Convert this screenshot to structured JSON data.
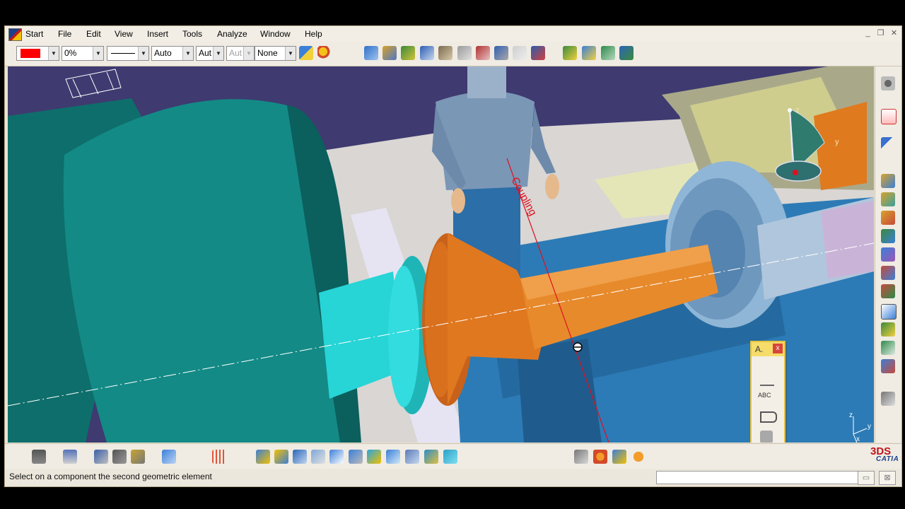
{
  "app": {
    "name": "CATIA",
    "brand_mark": "3DS"
  },
  "menu": {
    "items": [
      "Start",
      "File",
      "Edit",
      "View",
      "Insert",
      "Tools",
      "Analyze",
      "Window",
      "Help"
    ]
  },
  "window_controls": {
    "minimize": "_",
    "restore": "❐",
    "close": "✕"
  },
  "graphic_properties": {
    "fill_color": "#ff0000",
    "transparency": "0%",
    "line_type_icon": "solid-line-icon",
    "line_thickness": "Auto",
    "line_weight": "Aut",
    "point_symbol": "Aut",
    "layer": "None"
  },
  "annotation_toolbar": {
    "title": "A.",
    "close_label": "x",
    "text_tool_label": "ABC",
    "icons": [
      "leader-line-icon",
      "text-abc-icon",
      "flag-note-icon",
      "hand-annotation-icon",
      "annotation-3d-icon"
    ]
  },
  "viewport": {
    "annotation_text": "Coupling",
    "compass_axes": {
      "z": "z",
      "y": "y"
    },
    "corner_axes": {
      "z": "z",
      "y": "y",
      "x": "x"
    },
    "colors": {
      "background": "#3f3a70",
      "motor": "#138a86",
      "floor": "#d9d6d3",
      "coupling": "#e07820",
      "hub": "#27d4d6",
      "base": "#2c7bb6",
      "flange": "#8fb6d6",
      "annotation": "#e01020"
    }
  },
  "status": {
    "message": "Select on a component the second geometric element",
    "command_input": ""
  },
  "toolbar_icons": {
    "top": [
      "paint-brush-icon",
      "format-painter-icon",
      "assembly-constraint-icon",
      "product-icon",
      "components-icon",
      "manipulation-icon",
      "snap-icon",
      "measure-icon",
      "clash-icon",
      "section-icon",
      "selection-icon",
      "explode-icon",
      "update-icon",
      "product-structure-icon",
      "catalog-icon",
      "scenes-icon"
    ],
    "right": [
      "settings-gear-icon",
      "pdf-export-icon",
      "select-arrow-icon",
      "gear-constraint-icon",
      "gear-offset-icon",
      "gear-angle-icon",
      "insert-component-icon",
      "replace-component-icon",
      "reuse-pattern-icon",
      "multi-instantiation-icon",
      "annotation-text-icon",
      "flag-icon",
      "table-icon",
      "settings-cog-icon",
      "arrow-toggle-icon"
    ],
    "bottom": [
      "camera-icon",
      "print-icon",
      "fit-all-icon",
      "save-icon",
      "trash-icon",
      "plane-icon",
      "grid-icon",
      "pan-icon",
      "zoom-in-icon",
      "zoom-out-icon",
      "normal-view-icon",
      "rotate-icon",
      "cube-view-icon",
      "isometric-icon",
      "render-style-icon",
      "hide-show-icon",
      "swap-icon",
      "compass-icon",
      "light-icon"
    ]
  }
}
